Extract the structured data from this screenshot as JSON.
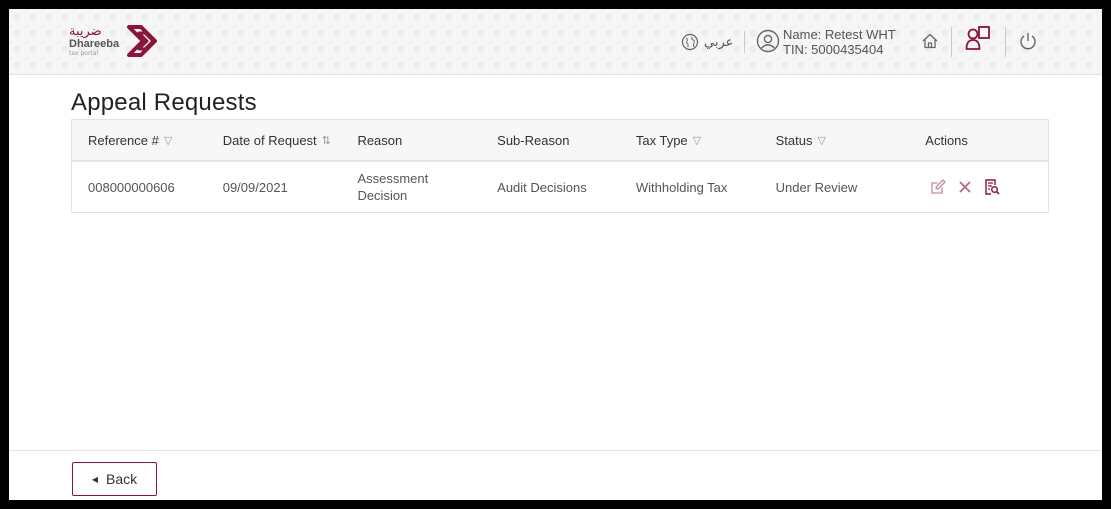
{
  "brand": {
    "logo_arabic": "ضريبة",
    "logo_english": "Dhareeba",
    "logo_sub": "tax portal",
    "color": "#8a1538"
  },
  "header": {
    "language_label": "عربي",
    "user_name": "Name: Retest WHT",
    "user_tin": "TIN: 5000435404",
    "icons": [
      "globe-icon",
      "user-icon",
      "home-icon",
      "account-icon",
      "power-icon"
    ]
  },
  "page": {
    "title": "Appeal Requests"
  },
  "table": {
    "columns": [
      {
        "label": "Reference #",
        "control": "filter"
      },
      {
        "label": "Date of Request",
        "control": "sort"
      },
      {
        "label": "Reason",
        "control": null
      },
      {
        "label": "Sub-Reason",
        "control": null
      },
      {
        "label": "Tax Type",
        "control": "filter"
      },
      {
        "label": "Status",
        "control": "filter"
      },
      {
        "label": "Actions",
        "control": null
      }
    ],
    "rows": [
      {
        "reference": "008000000606",
        "date": "09/09/2021",
        "reason": "Assessment Decision",
        "sub_reason": "Audit Decisions",
        "tax_type": "Withholding Tax",
        "status": "Under Review",
        "actions": [
          "edit-icon",
          "cancel-icon",
          "view-document-icon"
        ]
      }
    ]
  },
  "footer": {
    "back_label": "Back"
  },
  "colors": {
    "accent": "#8a1538",
    "action_icon": "#c98a9c",
    "header_bg": "#f6f6f6"
  }
}
